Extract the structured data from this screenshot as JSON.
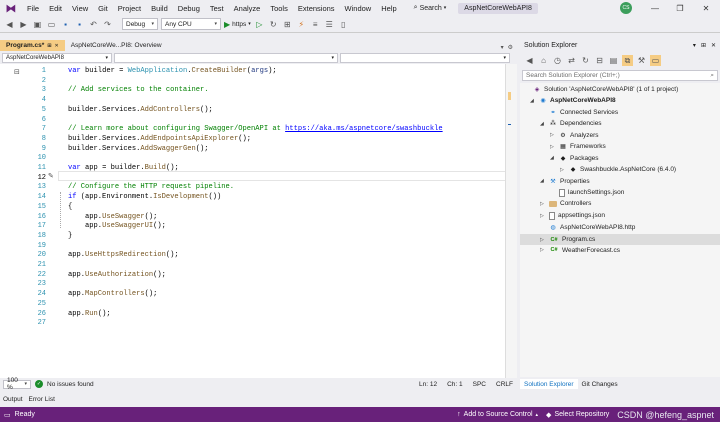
{
  "menubar": {
    "items": [
      "File",
      "Edit",
      "View",
      "Git",
      "Project",
      "Build",
      "Debug",
      "Test",
      "Analyze",
      "Tools",
      "Extensions",
      "Window",
      "Help"
    ],
    "search_label": "Search",
    "project_title": "AspNetCoreWebAPI8",
    "avatar_initials": "CS"
  },
  "toolbar": {
    "config": "Debug",
    "platform": "Any CPU",
    "run_label": "https"
  },
  "editor": {
    "tabs": [
      "Program.cs*",
      "AspNetCoreWe...PI8: Overview"
    ],
    "nav_project": "AspNetCoreWebAPI8",
    "line_numbers": [
      "1",
      "2",
      "3",
      "4",
      "5",
      "6",
      "7",
      "8",
      "9",
      "10",
      "11",
      "12",
      "13",
      "14",
      "15",
      "16",
      "17",
      "18",
      "19",
      "20",
      "21",
      "22",
      "23",
      "24",
      "25",
      "26",
      "27"
    ],
    "code": {
      "l1_kw": "var",
      "l1_a": " builder = ",
      "l1_ty": "WebApplication",
      "l1_b": ".",
      "l1_me": "CreateBuilder",
      "l1_c": "(",
      "l1_pm": "args",
      "l1_d": ");",
      "l3": "// Add services to the container.",
      "l5_a": "builder.Services.",
      "l5_me": "AddControllers",
      "l5_b": "();",
      "l7_cm": "// Learn more about configuring Swagger/OpenAPI at ",
      "l7_link": "https://aka.ms/aspnetcore/swashbuckle",
      "l8_a": "builder.Services.",
      "l8_me": "AddEndpointsApiExplorer",
      "l8_b": "();",
      "l9_a": "builder.Services.",
      "l9_me": "AddSwaggerGen",
      "l9_b": "();",
      "l11_kw": "var",
      "l11_a": " app = builder.",
      "l11_me": "Build",
      "l11_b": "();",
      "l13": "// Configure the HTTP request pipeline.",
      "l14_kw": "if",
      "l14_a": " (app.Environment.",
      "l14_me": "IsDevelopment",
      "l14_b": "())",
      "l15": "{",
      "l16_a": "    app.",
      "l16_me": "UseSwagger",
      "l16_b": "();",
      "l17_a": "    app.",
      "l17_me": "UseSwaggerUI",
      "l17_b": "();",
      "l18": "}",
      "l20_a": "app.",
      "l20_me": "UseHttpsRedirection",
      "l20_b": "();",
      "l22_a": "app.",
      "l22_me": "UseAuthorization",
      "l22_b": "();",
      "l24_a": "app.",
      "l24_me": "MapControllers",
      "l24_b": "();",
      "l26_a": "app.",
      "l26_me": "Run",
      "l26_b": "();"
    }
  },
  "editor_status": {
    "zoom": "100 %",
    "issues": "No issues found",
    "line": "Ln: 12",
    "col": "Ch: 1",
    "whitespace": "SPC",
    "line_ending": "CRLF"
  },
  "bottom_tabs": [
    "Output",
    "Error List"
  ],
  "statusbar": {
    "ready": "Ready",
    "add_source": "Add to Source Control",
    "select_repo": "Select Repository",
    "watermark": "CSDN @hefeng_aspnet"
  },
  "solution_explorer": {
    "title": "Solution Explorer",
    "search_placeholder": "Search Solution Explorer (Ctrl+;)",
    "nodes": {
      "solution": "Solution 'AspNetCoreWebAPI8' (1 of 1 project)",
      "project": "AspNetCoreWebAPI8",
      "connected": "Connected Services",
      "dependencies": "Dependencies",
      "analyzers": "Analyzers",
      "frameworks": "Frameworks",
      "packages": "Packages",
      "swashbuckle": "Swashbuckle.AspNetCore (6.4.0)",
      "properties": "Properties",
      "launch": "launchSettings.json",
      "controllers": "Controllers",
      "appsettings": "appsettings.json",
      "http": "AspNetCoreWebAPI8.http",
      "program": "Program.cs",
      "weather": "WeatherForecast.cs"
    },
    "bottom_tabs": [
      "Solution Explorer",
      "Git Changes"
    ]
  },
  "colors": {
    "accent": "#68217a",
    "active_tab": "#f5cc84",
    "keyword": "#0000ff",
    "type": "#2b91af",
    "method": "#74531f",
    "comment": "#008000"
  }
}
